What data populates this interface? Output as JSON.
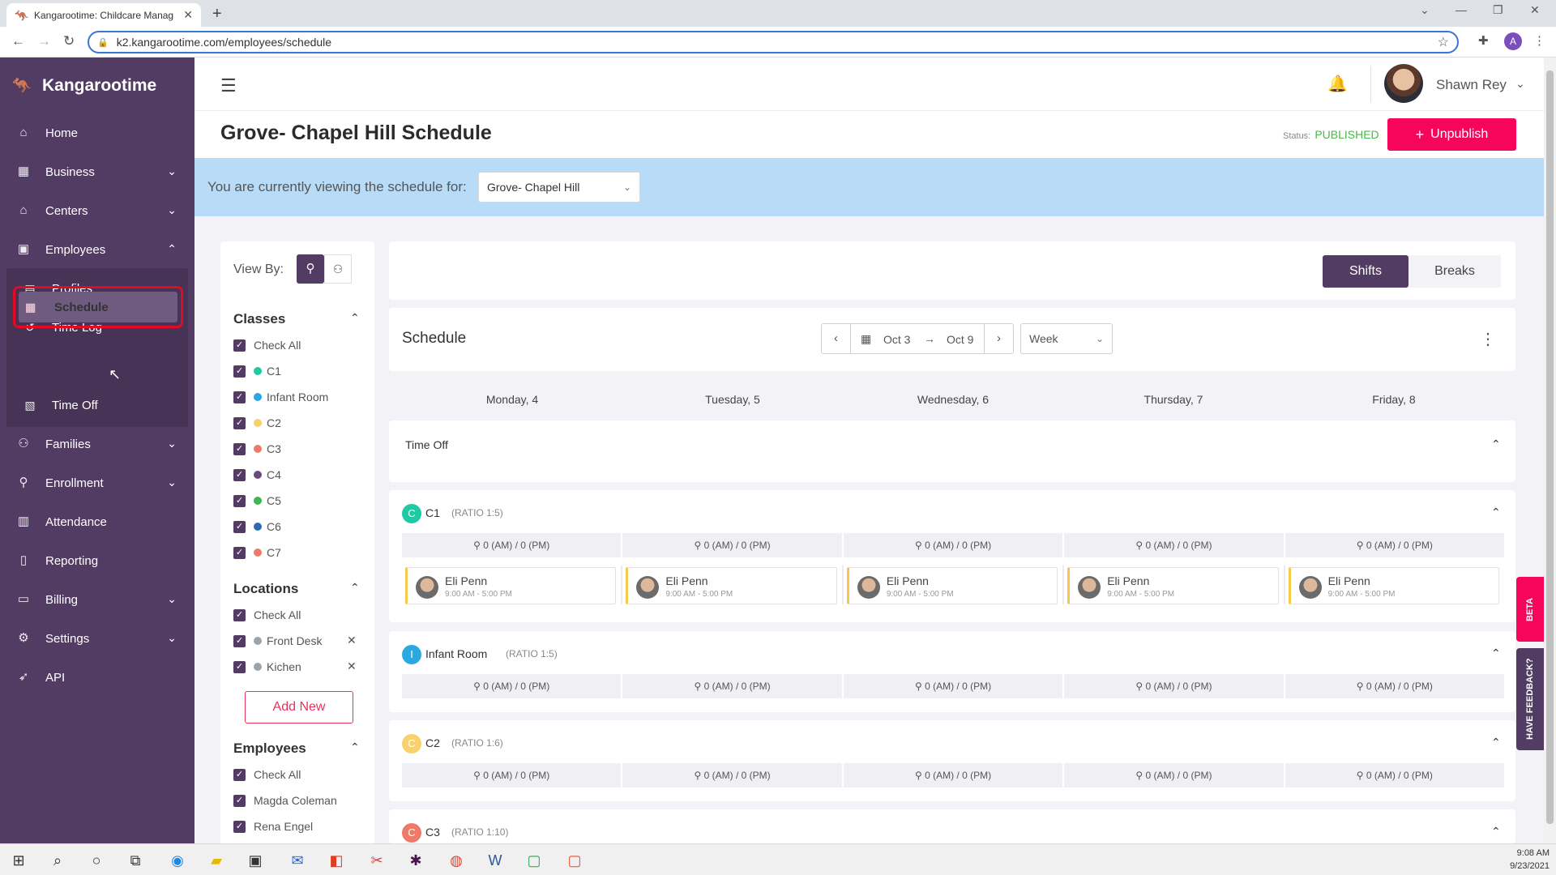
{
  "browser": {
    "tab_title": "Kangarootime: Childcare Manag",
    "url": "k2.kangarootime.com/employees/schedule",
    "profile_initial": "A"
  },
  "app": {
    "brand": "Kangarootime",
    "colors": {
      "sidebar": "#533c63",
      "accent": "#f5065a",
      "highlight": "#e30b24",
      "published": "#4bb64b"
    },
    "nav": [
      {
        "label": "Home",
        "icon": "home-icon"
      },
      {
        "label": "Business",
        "icon": "building-icon"
      },
      {
        "label": "Centers",
        "icon": "center-icon"
      },
      {
        "label": "Employees",
        "icon": "badge-icon"
      },
      {
        "label": "Families",
        "icon": "people-icon"
      },
      {
        "label": "Enrollment",
        "icon": "add-person-icon"
      },
      {
        "label": "Attendance",
        "icon": "calendar-check-icon"
      },
      {
        "label": "Reporting",
        "icon": "report-icon"
      },
      {
        "label": "Billing",
        "icon": "card-icon"
      },
      {
        "label": "Settings",
        "icon": "gear-icon"
      },
      {
        "label": "API",
        "icon": "rocket-icon"
      }
    ],
    "employees_sub": [
      {
        "label": "Profiles"
      },
      {
        "label": "Time Log"
      },
      {
        "label": "Schedule"
      },
      {
        "label": "Time Off"
      }
    ]
  },
  "header": {
    "user_name": "Shawn Rey",
    "page_title": "Grove- Chapel Hill Schedule",
    "status_label": "Status:",
    "status_value": "PUBLISHED",
    "unpublish_label": "Unpublish"
  },
  "banner": {
    "text": "You are currently viewing the schedule for:",
    "selected_center": "Grove- Chapel Hill"
  },
  "filters": {
    "view_by_label": "View By:",
    "classes_title": "Classes",
    "classes": [
      {
        "label": "Check All",
        "color": ""
      },
      {
        "label": "C1",
        "color": "#1ec9a3"
      },
      {
        "label": "Infant Room",
        "color": "#2aa8e0"
      },
      {
        "label": "C2",
        "color": "#f7d26b"
      },
      {
        "label": "C3",
        "color": "#f07a6a"
      },
      {
        "label": "C4",
        "color": "#6b4a7c"
      },
      {
        "label": "C5",
        "color": "#3fb64f"
      },
      {
        "label": "C6",
        "color": "#2f6bb5"
      },
      {
        "label": "C7",
        "color": "#f07a6a"
      }
    ],
    "locations_title": "Locations",
    "locations": [
      {
        "label": "Check All",
        "color": ""
      },
      {
        "label": "Front Desk",
        "color": "#9aa4ae"
      },
      {
        "label": "Kichen",
        "color": "#9aa4ae"
      }
    ],
    "add_new_label": "Add New",
    "employees_title": "Employees",
    "employees": [
      {
        "label": "Check All"
      },
      {
        "label": "Magda Coleman"
      },
      {
        "label": "Rena Engel"
      }
    ]
  },
  "schedule": {
    "toggle_shifts": "Shifts",
    "toggle_breaks": "Breaks",
    "title": "Schedule",
    "date_from": "Oct 3",
    "date_to": "Oct 9",
    "period": "Week",
    "days": [
      "Monday, 4",
      "Tuesday, 5",
      "Wednesday, 6",
      "Thursday, 7",
      "Friday, 8"
    ],
    "time_off_label": "Time Off",
    "staff_count": "0 (AM) / 0 (PM)",
    "classes": [
      {
        "initial": "C",
        "name": "C1",
        "ratio": "(RATIO 1:5)",
        "color": "#1ec9a3"
      },
      {
        "initial": "I",
        "name": "Infant Room",
        "ratio": "(RATIO 1:5)",
        "color": "#2aa8e0"
      },
      {
        "initial": "C",
        "name": "C2",
        "ratio": "(RATIO 1:6)",
        "color": "#f7d26b"
      },
      {
        "initial": "C",
        "name": "C3",
        "ratio": "(RATIO 1:10)",
        "color": "#f07a6a"
      }
    ],
    "shift": {
      "employee": "Eli Penn",
      "time": "9:00 AM - 5:00 PM"
    }
  },
  "side_tabs": {
    "beta": "BETA",
    "feedback": "HAVE FEEDBACK?"
  },
  "taskbar": {
    "time": "9:08 AM",
    "date": "9/23/2021"
  }
}
